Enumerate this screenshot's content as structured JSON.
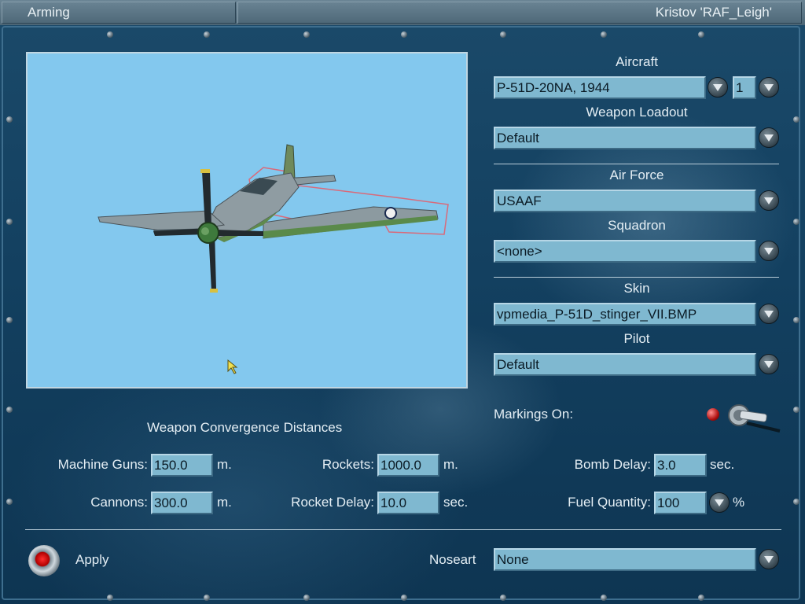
{
  "window": {
    "title": "Arming",
    "user": "Kristov 'RAF_Leigh'"
  },
  "aircraft": {
    "label": "Aircraft",
    "value": "P-51D-20NA, 1944",
    "count": "1"
  },
  "weapon_loadout": {
    "label": "Weapon Loadout",
    "value": "Default"
  },
  "air_force": {
    "label": "Air Force",
    "value": "USAAF"
  },
  "squadron": {
    "label": "Squadron",
    "value": "<none>"
  },
  "skin": {
    "label": "Skin",
    "value": "vpmedia_P-51D_stinger_VII.BMP"
  },
  "pilot": {
    "label": "Pilot",
    "value": "Default"
  },
  "markings": {
    "label": "Markings On:",
    "on": true
  },
  "convergence": {
    "title": "Weapon Convergence Distances",
    "machine_guns": {
      "label": "Machine Guns:",
      "value": "150.0",
      "unit": "m."
    },
    "cannons": {
      "label": "Cannons:",
      "value": "300.0",
      "unit": "m."
    },
    "rockets": {
      "label": "Rockets:",
      "value": "1000.0",
      "unit": "m."
    },
    "rocket_delay": {
      "label": "Rocket Delay:",
      "value": "10.0",
      "unit": "sec."
    },
    "bomb_delay": {
      "label": "Bomb Delay:",
      "value": "3.0",
      "unit": "sec."
    },
    "fuel": {
      "label": "Fuel Quantity:",
      "value": "100",
      "unit": "%"
    }
  },
  "apply": {
    "label": "Apply"
  },
  "noseart": {
    "label": "Noseart",
    "value": "None"
  },
  "colors": {
    "panel_bg": "#134060",
    "field_bg": "#7fb8d0",
    "preview_sky": "#83c8ee"
  },
  "icons": [
    "dropdown-arrow-icon",
    "toggle-switch-icon",
    "apply-button-icon",
    "cursor-icon"
  ]
}
